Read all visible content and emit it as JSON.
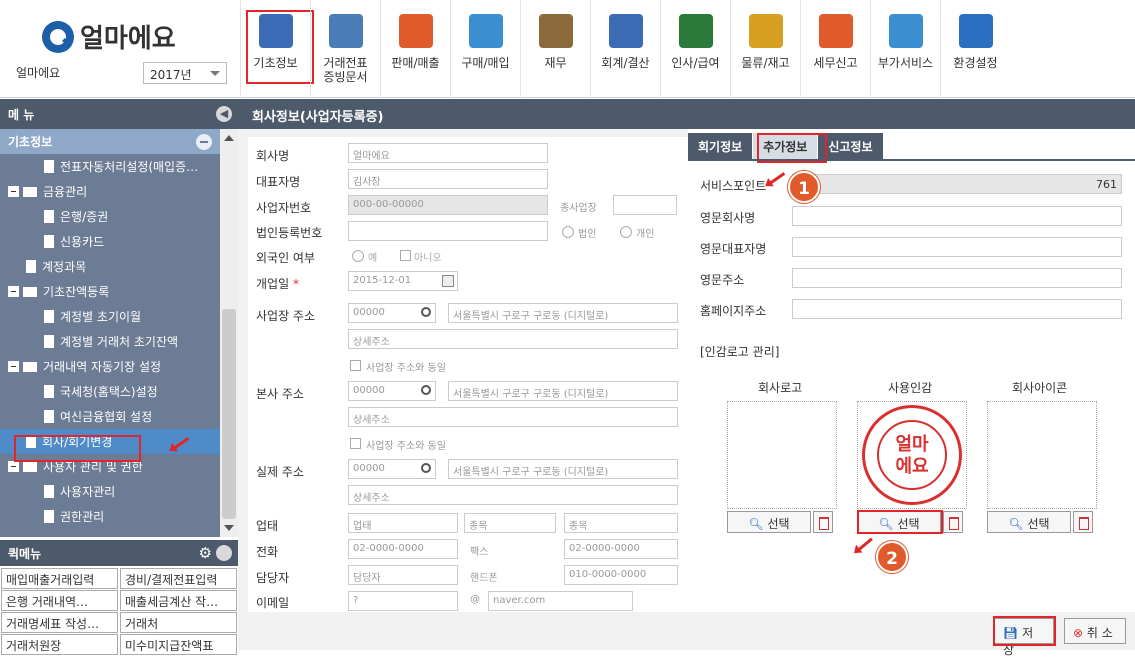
{
  "app": {
    "logo_text": "얼마에요",
    "company": "얼마에요",
    "year": "2017년"
  },
  "toolbar": [
    {
      "label": "기초정보",
      "icon": "basic-info-icon",
      "color": "#3b6bb5"
    },
    {
      "label": "거래전표\n증빙문서",
      "icon": "voucher-icon",
      "color": "#4a7db5"
    },
    {
      "label": "판매/매출",
      "icon": "sales-icon",
      "color": "#e05a2b"
    },
    {
      "label": "구매/매입",
      "icon": "purchase-icon",
      "color": "#3b8fd0"
    },
    {
      "label": "재무",
      "icon": "money-bag-icon",
      "color": "#8a6a3a"
    },
    {
      "label": "회계/결산",
      "icon": "accounting-icon",
      "color": "#3b6bb5"
    },
    {
      "label": "인사/급여",
      "icon": "person-icon",
      "color": "#2b7a3a"
    },
    {
      "label": "물류/재고",
      "icon": "logistics-icon",
      "color": "#d8a020"
    },
    {
      "label": "세무신고",
      "icon": "tax-icon",
      "color": "#e05a2b"
    },
    {
      "label": "부가서비스",
      "icon": "bank-icon",
      "color": "#3b8fd0"
    },
    {
      "label": "환경설정",
      "icon": "gear-icon",
      "color": "#2b6fc0"
    }
  ],
  "sidebar": {
    "title": "메 뉴",
    "group": "기초정보",
    "items": [
      {
        "label": "전표자동처리설정(매입증…",
        "kind": "doc",
        "indent": 2
      },
      {
        "label": "금융관리",
        "kind": "folder",
        "indent": 0
      },
      {
        "label": "은행/증권",
        "kind": "doc",
        "indent": 2
      },
      {
        "label": "신용카드",
        "kind": "doc",
        "indent": 2
      },
      {
        "label": "계정과목",
        "kind": "doc",
        "indent": 1
      },
      {
        "label": "기초잔액등록",
        "kind": "folder",
        "indent": 0
      },
      {
        "label": "계정별 초기이월",
        "kind": "doc",
        "indent": 2
      },
      {
        "label": "계정별 거래처 초기잔액",
        "kind": "doc",
        "indent": 2
      },
      {
        "label": "거래내역 자동기장 설정",
        "kind": "folder",
        "indent": 0
      },
      {
        "label": "국세청(홈택스)설정",
        "kind": "doc",
        "indent": 2
      },
      {
        "label": "여신금융협회 설정",
        "kind": "doc",
        "indent": 2
      },
      {
        "label": "회사/회기변경",
        "kind": "doc",
        "indent": 1,
        "selected": true
      },
      {
        "label": "사용자 관리 및 권한",
        "kind": "folder",
        "indent": 0
      },
      {
        "label": "사용자관리",
        "kind": "doc",
        "indent": 2
      },
      {
        "label": "권한관리",
        "kind": "doc",
        "indent": 2
      }
    ]
  },
  "quickmenu": {
    "title": "퀵메뉴",
    "items": [
      "매입매출거래입력",
      "경비/결제전표입력",
      "은행 거래내역…",
      "매출세금계산 작…",
      "거래명세표 작성…",
      "거래처",
      "거래처원장",
      "미수미지급잔액표"
    ]
  },
  "main": {
    "title": "회사정보(사업자등록증)"
  },
  "form": {
    "company_name_label": "회사명",
    "company_name": "얼마에요",
    "ceo_label": "대표자명",
    "ceo": "김사장",
    "bizno_label": "사업자번호",
    "bizno": "000-00-00000",
    "type_label": "종사업장",
    "corpno_label": "법인등록번호",
    "corp_label": "법인",
    "personal_label": "개인",
    "foreign_label": "외국인 여부",
    "yes_label": "예",
    "no_label": "아니오",
    "open_date_label": "개업일",
    "open_date": "2015-12-01",
    "biz_addr_label": "사업장 주소",
    "zip1": "00000",
    "addr1": "서울특별시 구로구 구로동 (디지털로)",
    "addr1_detail": "상세주소",
    "same_label": "사업장 주소와 동일",
    "head_addr_label": "본사 주소",
    "zip2": "00000",
    "addr2": "서울특별시 구로구 구로동 (디지털로)",
    "addr2_detail": "상세주소",
    "real_addr_label": "실제 주소",
    "zip3": "00000",
    "addr3": "서울특별시 구로구 구로동 (디지털로)",
    "addr3_detail": "상세주소",
    "biztype_label": "업태",
    "biztype": "업태",
    "bizitem_label": "종목",
    "bizitem": "종목",
    "bizitem2": "종목",
    "phone_label": "전화",
    "phone": "02-0000-0000",
    "fax_label": "팩스",
    "fax": "02-0000-0000",
    "manager_label": "담당자",
    "manager": "담당자",
    "mobile_label": "핸드폰",
    "mobile": "010-0000-0000",
    "email_label": "이메일",
    "email_id": "?",
    "email_at": "@",
    "email_domain": "naver.com"
  },
  "right": {
    "tabs": [
      "회기정보",
      "추가정보",
      "신고정보"
    ],
    "service_point_label": "서비스포인트",
    "service_point": "761",
    "eng_name_label": "영문회사명",
    "eng_ceo_label": "영문대표자명",
    "eng_addr_label": "영문주소",
    "homepage_label": "홈페이지주소",
    "seal_section": "[인감로고 관리]",
    "logo_label": "회사로고",
    "seal_label": "사용인감",
    "icon_label": "회사아이콘",
    "select_label": "선택",
    "seal_text": "얼마\n에요",
    "badge1": "1",
    "badge2": "2"
  },
  "buttons": {
    "save": "저 장",
    "cancel": "취 소"
  },
  "colors": {
    "header": "#4d5a6b",
    "menu_bg": "#6b7c94",
    "accent_red": "#e0262a",
    "badge": "#e05a2b"
  }
}
